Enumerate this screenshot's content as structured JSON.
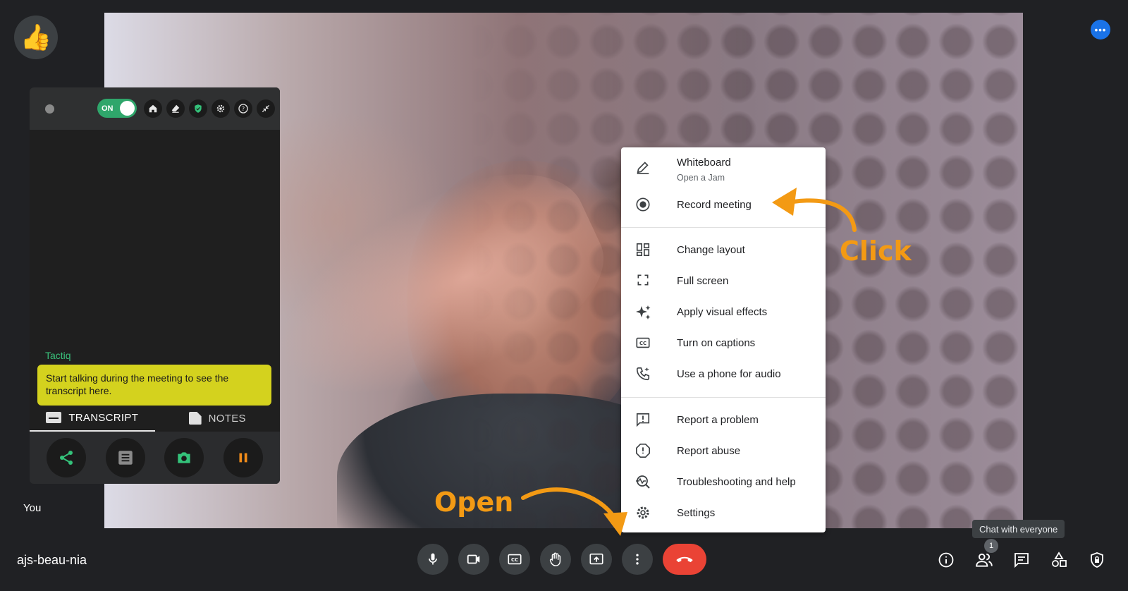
{
  "meeting": {
    "code": "ajs-beau-nia",
    "self_label": "You"
  },
  "reaction_emoji": "👍",
  "top_right_more": "•••",
  "tactiq": {
    "toggle_label": "ON",
    "header_icons": [
      "home-icon",
      "eraser-icon",
      "shield-icon",
      "gear-icon",
      "help-icon",
      "collapse-icon"
    ],
    "brand_label": "Tactiq",
    "empty_message": "Start talking during the meeting to see the transcript here.",
    "tabs": [
      {
        "label": "TRANSCRIPT",
        "active": true
      },
      {
        "label": "NOTES",
        "active": false
      }
    ],
    "actions": [
      "share-icon",
      "document-icon",
      "camera-icon",
      "pause-icon"
    ]
  },
  "menu": {
    "items": [
      {
        "label": "Whiteboard",
        "sublabel": "Open a Jam",
        "icon": "pencil-icon"
      },
      {
        "label": "Record meeting",
        "icon": "record-icon"
      },
      {
        "label": "Change layout",
        "icon": "layout-icon"
      },
      {
        "label": "Full screen",
        "icon": "fullscreen-icon"
      },
      {
        "label": "Apply visual effects",
        "icon": "sparkle-icon"
      },
      {
        "label": "Turn on captions",
        "icon": "captions-icon"
      },
      {
        "label": "Use a phone for audio",
        "icon": "phone-icon"
      },
      {
        "label": "Report a problem",
        "icon": "feedback-icon"
      },
      {
        "label": "Report abuse",
        "icon": "alert-icon"
      },
      {
        "label": "Troubleshooting and help",
        "icon": "troubleshoot-icon"
      },
      {
        "label": "Settings",
        "icon": "gear-icon"
      }
    ]
  },
  "annotations": {
    "click": "Click",
    "open": "Open"
  },
  "controls": {
    "center": [
      "microphone-icon",
      "camera-icon",
      "captions-icon",
      "raise-hand-icon",
      "present-icon",
      "more-options-icon",
      "end-call-icon"
    ],
    "right": [
      "info-icon",
      "people-icon",
      "chat-icon",
      "activities-icon",
      "host-controls-icon"
    ],
    "tooltip": "Chat with everyone",
    "participants_badge": "1"
  },
  "colors": {
    "accent_blue": "#1a73e8",
    "end_call_red": "#ea4335",
    "tactiq_green": "#34c27a",
    "annotation_orange": "#f39a14",
    "bubble_yellow": "#d4d21e"
  }
}
